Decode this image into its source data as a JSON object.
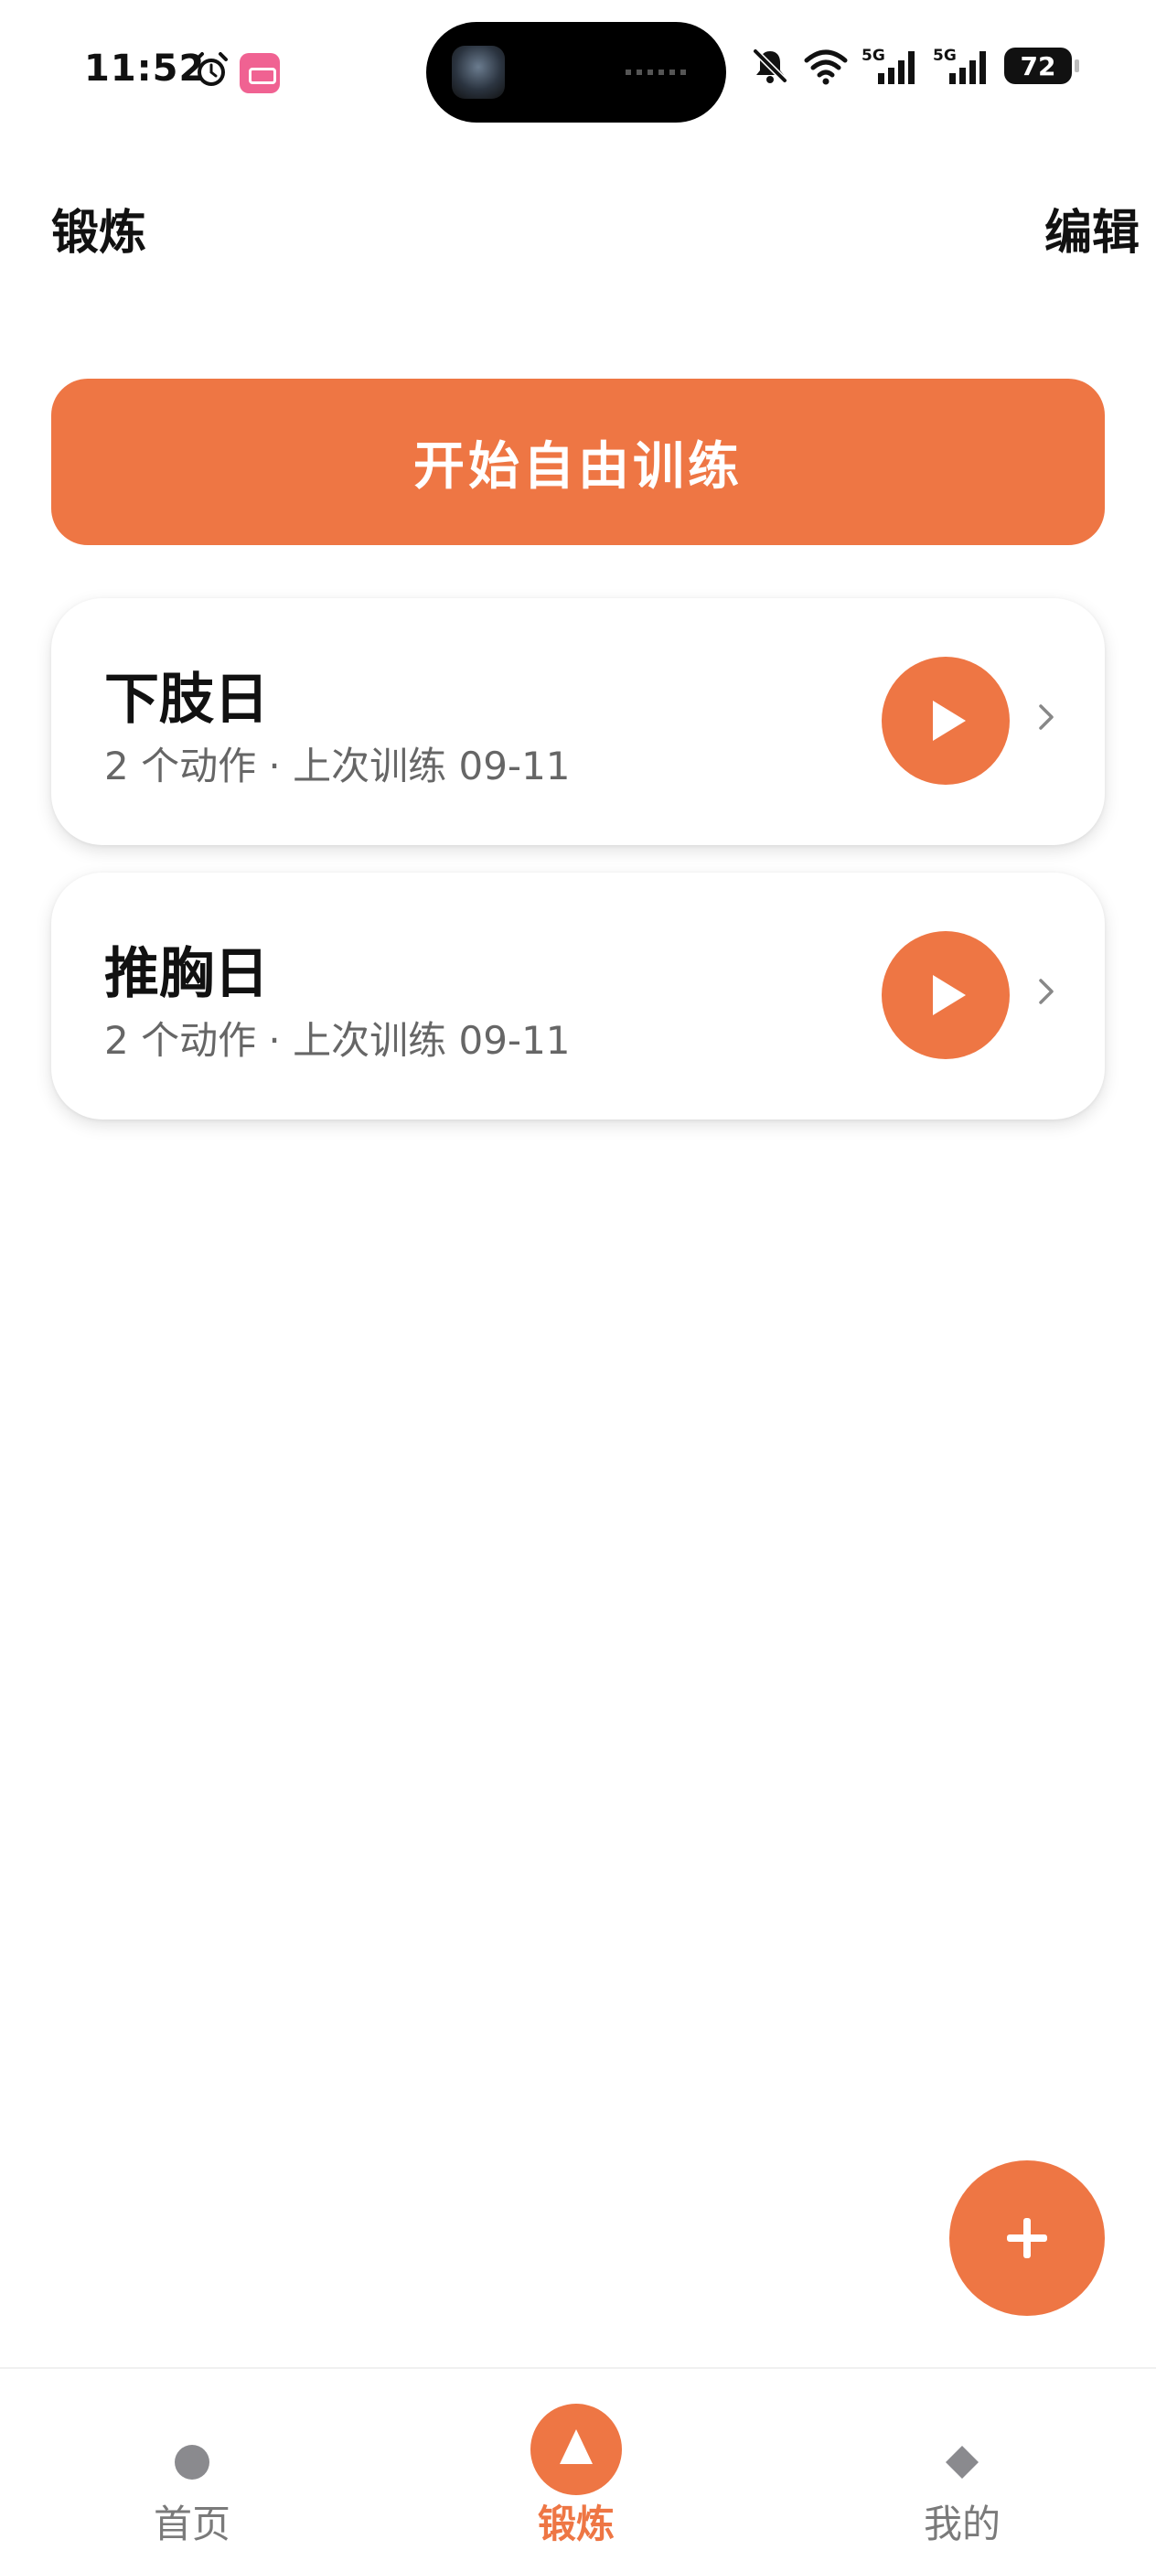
{
  "status_bar": {
    "time": "11:52",
    "battery": "72",
    "signal_1": "5G",
    "signal_2": "5G"
  },
  "header": {
    "title": "锻炼",
    "edit": "编辑"
  },
  "start_button": {
    "label": "开始自由训练"
  },
  "workouts": [
    {
      "name": "下肢日",
      "subtitle": "2 个动作 · 上次训练 09-11"
    },
    {
      "name": "推胸日",
      "subtitle": "2 个动作 · 上次训练 09-11"
    }
  ],
  "fab": {
    "icon": "plus-icon"
  },
  "bottom_nav": {
    "items": [
      {
        "label": "首页",
        "icon": "dot-icon"
      },
      {
        "label": "锻炼",
        "icon": "triangle-icon"
      },
      {
        "label": "我的",
        "icon": "diamond-icon"
      }
    ],
    "active": "锻炼"
  },
  "colors": {
    "accent": "#ee7644",
    "text_primary": "#111111",
    "text_secondary": "#666666"
  }
}
